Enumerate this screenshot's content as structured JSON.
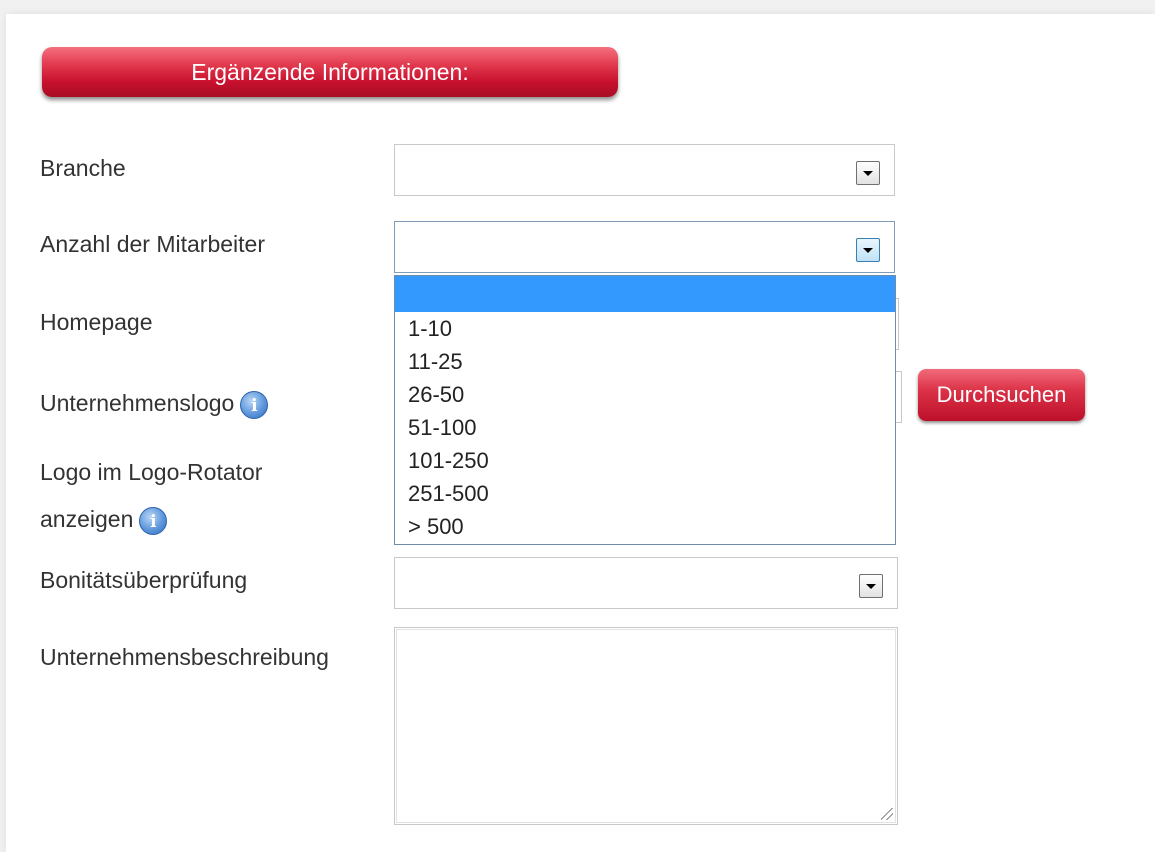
{
  "section": {
    "title": "Ergänzende Informationen:"
  },
  "fields": {
    "branche": {
      "label": "Branche",
      "value": ""
    },
    "mitarbeiter": {
      "label": "Anzahl der Mitarbeiter",
      "value": "",
      "options": [
        "",
        "1-10",
        "11-25",
        "26-50",
        "51-100",
        "101-250",
        "251-500",
        "> 500"
      ],
      "selected_index": 0
    },
    "homepage": {
      "label": "Homepage",
      "value": ""
    },
    "logo": {
      "label": "Unternehmenslogo",
      "browse_label": "Durchsuchen"
    },
    "rotator": {
      "label_line1": "Logo im Logo-Rotator",
      "label_line2": "anzeigen"
    },
    "bonitaet": {
      "label": "Bonitätsüberprüfung",
      "value": ""
    },
    "beschreibung": {
      "label": "Unternehmensbeschreibung",
      "value": ""
    }
  },
  "icons": {
    "info_glyph": "i",
    "info_icon": "info-icon",
    "dropdown_arrow": "chevron-down-icon"
  },
  "colors": {
    "accent_red": "#c8102e",
    "highlight_blue": "#3399ff",
    "info_blue": "#5e97dc"
  }
}
